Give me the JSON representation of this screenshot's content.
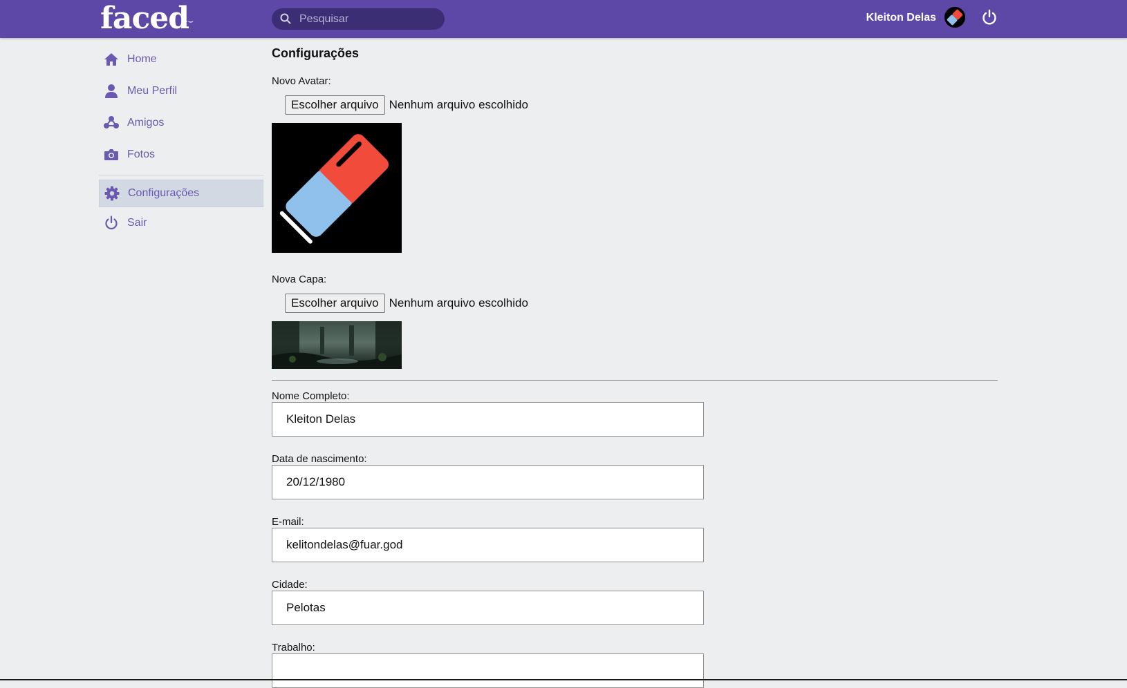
{
  "header": {
    "logo": "faced",
    "logo_smile": "ᵕ̈",
    "search_placeholder": "Pesquisar",
    "user_name": "Kleiton Delas"
  },
  "sidebar": {
    "items": [
      {
        "label": "Home",
        "icon": "home-icon"
      },
      {
        "label": "Meu Perfil",
        "icon": "user-icon"
      },
      {
        "label": "Amigos",
        "icon": "friends-icon"
      },
      {
        "label": "Fotos",
        "icon": "camera-icon"
      },
      {
        "label": "Configurações",
        "icon": "gear-icon",
        "active": true
      },
      {
        "label": "Sair",
        "icon": "power-icon"
      }
    ]
  },
  "main": {
    "title": "Configurações",
    "avatar": {
      "label": "Novo Avatar:",
      "button": "Escolher arquivo",
      "status": "Nenhum arquivo escolhido"
    },
    "cover": {
      "label": "Nova Capa:",
      "button": "Escolher arquivo",
      "status": "Nenhum arquivo escolhido"
    },
    "fields": [
      {
        "label": "Nome Completo:",
        "value": "Kleiton Delas"
      },
      {
        "label": "Data de nascimento:",
        "value": "20/12/1980"
      },
      {
        "label": "E-mail:",
        "value": "kelitondelas@fuar.god"
      },
      {
        "label": "Cidade:",
        "value": "Pelotas"
      },
      {
        "label": "Trabalho:",
        "value": ""
      }
    ]
  },
  "colors": {
    "header_bg": "#5d48a8",
    "search_bg": "#3c2e75",
    "sidebar_text": "#6a59b0",
    "page_bg": "#edeef0",
    "eraser_red": "#f14b3c",
    "eraser_blue": "#8fc1ec"
  }
}
